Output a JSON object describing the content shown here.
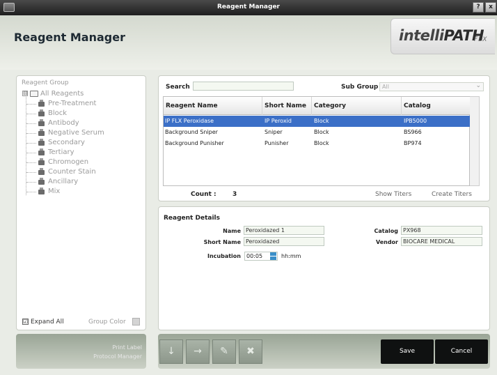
{
  "window": {
    "title": "Reagent Manager",
    "help_btn": "?",
    "close_btn": "x"
  },
  "header": {
    "page_title": "Reagent Manager",
    "logo_prefix": "intelli",
    "logo_main": "PATH",
    "logo_suffix": "FLX"
  },
  "sidebar": {
    "group_title": "Reagent Group",
    "root": "All Reagents",
    "root_expander": "⊟",
    "items": [
      "Pre-Treatment",
      "Block",
      "Antibody",
      "Negative Serum",
      "Secondary",
      "Tertiary",
      "Chromogen",
      "Counter Stain",
      "Ancillary",
      "Mix"
    ],
    "expand_all_label": "Expand All",
    "expand_all_checked": "☑",
    "group_color_label": "Group Color",
    "links": [
      "Print Label",
      "Protocol Manager"
    ]
  },
  "search": {
    "label": "Search",
    "value": "",
    "subgroup_label": "Sub Group",
    "subgroup_value": "All"
  },
  "table": {
    "columns": [
      "Reagent Name",
      "Short Name",
      "Category",
      "Catalog"
    ],
    "rows": [
      {
        "name": "IP FLX Peroxidase",
        "short": "IP Peroxid",
        "category": "Block",
        "catalog": "IPB5000"
      },
      {
        "name": "Background Sniper",
        "short": "Sniper",
        "category": "Block",
        "catalog": "BS966"
      },
      {
        "name": "Background Punisher",
        "short": "Punisher",
        "category": "Block",
        "catalog": "BP974"
      }
    ],
    "count_label": "Count :",
    "count_value": "3",
    "show_titers": "Show Titers",
    "create_titers": "Create Titers"
  },
  "details": {
    "title": "Reagent Details",
    "name_label": "Name",
    "name_value": "Peroxidazed 1",
    "short_label": "Short Name",
    "short_value": "Peroxidazed",
    "incubation_label": "Incubation",
    "incubation_value": "00:05",
    "incubation_unit": "hh:mm",
    "catalog_label": "Catalog",
    "catalog_value": "PX968",
    "vendor_label": "Vendor",
    "vendor_value": "BIOCARE MEDICAL"
  },
  "toolbar": {
    "down": "↓",
    "right": "→",
    "edit": "✎",
    "delete": "✖",
    "save": "Save",
    "cancel": "Cancel"
  }
}
